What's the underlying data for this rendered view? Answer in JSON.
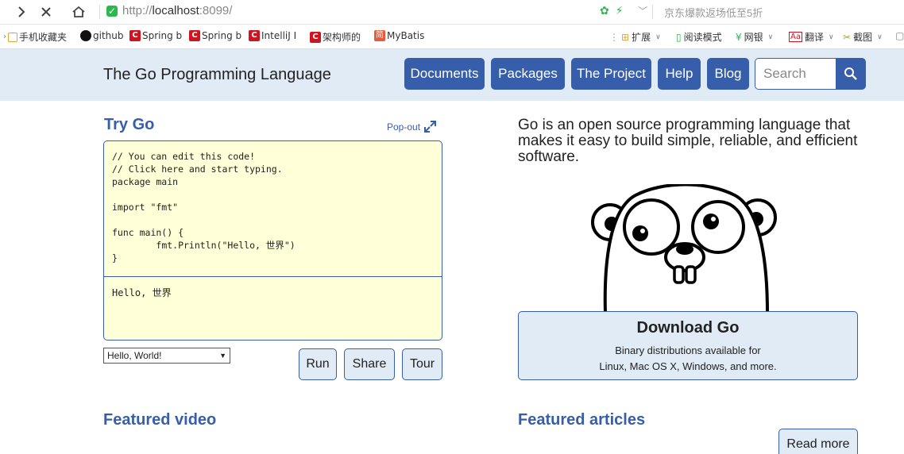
{
  "browser": {
    "url_scheme": "http://",
    "url_host": "localhost",
    "url_rest": ":8099/",
    "suggestion": "京东爆款返场低至5折",
    "bookmarks": [
      "手机收藏夹",
      "github",
      "Spring b",
      "Spring b",
      "IntelliJ I",
      "架构师的",
      "MyBatis"
    ],
    "toolbar": [
      "扩展",
      "阅读模式",
      "网银",
      "翻译",
      "截图"
    ]
  },
  "header": {
    "title": "The Go Programming Language",
    "nav": [
      "Documents",
      "Packages",
      "The Project",
      "Help",
      "Blog"
    ],
    "search_placeholder": "Search"
  },
  "playground": {
    "title": "Try Go",
    "popout_label": "Pop-out",
    "code": "// You can edit this code!\n// Click here and start typing.\npackage main\n\nimport \"fmt\"\n\nfunc main() {\n\tfmt.Println(\"Hello, 世界\")\n}",
    "output": "Hello, 世界",
    "example_selected": "Hello, World!",
    "buttons": {
      "run": "Run",
      "share": "Share",
      "tour": "Tour"
    }
  },
  "about": {
    "text": "Go is an open source programming language that makes it easy to build simple, reliable, and efficient software."
  },
  "download": {
    "title": "Download Go",
    "line1": "Binary distributions available for",
    "line2": "Linux, Mac OS X, Windows, and more."
  },
  "featured": {
    "video_title": "Featured video",
    "articles_title": "Featured articles",
    "read_more": "Read more"
  },
  "colors": {
    "brand": "#375eab",
    "header_bg": "#e0ebf5",
    "code_bg": "#ffffd8"
  }
}
